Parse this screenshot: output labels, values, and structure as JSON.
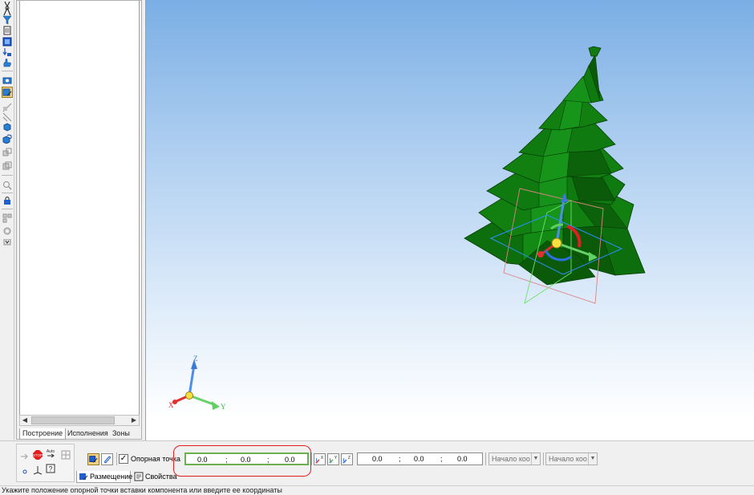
{
  "tree_panel": {
    "tabs": [
      "Построение",
      "Исполнения",
      "Зоны"
    ]
  },
  "viewport": {
    "triad_labels": {
      "x": "X",
      "y": "Y",
      "z": "Z"
    }
  },
  "property_panel": {
    "reference_point": {
      "label": "Опорная точка",
      "checked": true,
      "values": [
        "0.0",
        "0.0",
        "0.0"
      ]
    },
    "angles": {
      "values": [
        "0.0",
        "0.0",
        "0.0"
      ]
    },
    "origin_combos": [
      "Начало коо",
      "Начало коо"
    ],
    "tabs": [
      "Размещение",
      "Свойства"
    ]
  },
  "status_bar": {
    "text": "Укажите положение опорной точки вставки компонента или введите ее  координаты"
  },
  "colors": {
    "tree_green": "#0e7a0e",
    "tree_dark": "#0a5a0a",
    "highlight_red": "#e02020",
    "field_green": "#6db04f"
  }
}
